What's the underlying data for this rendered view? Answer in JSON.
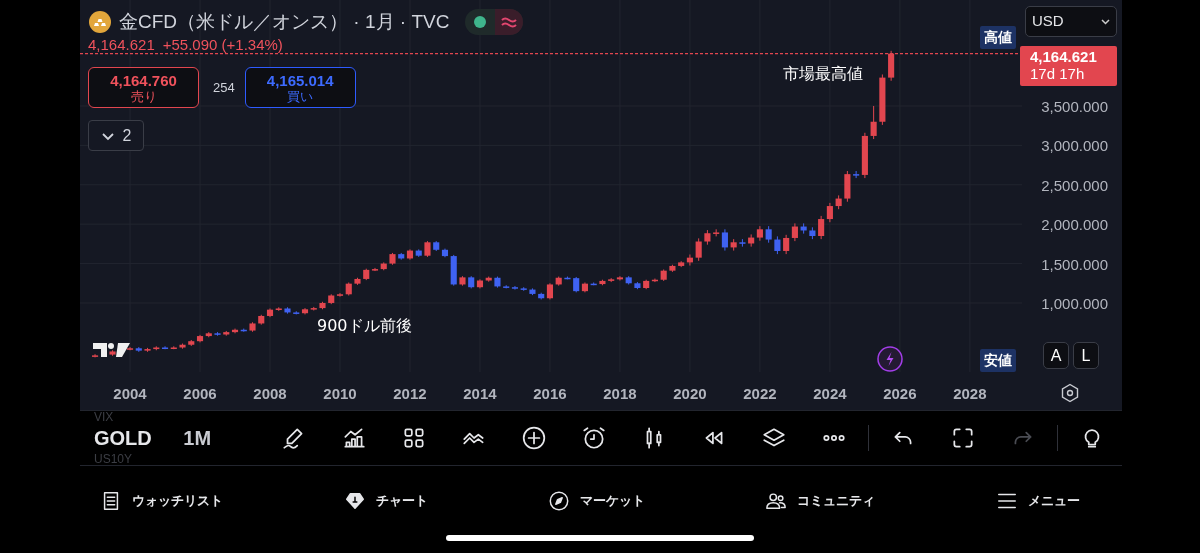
{
  "header": {
    "title": "金CFD（米ドル／オンス）",
    "meta": "· 1月 · TVC",
    "last": "4,164.621",
    "change": "+55.090 (+1.34%)"
  },
  "trade": {
    "sell_price": "4,164.760",
    "sell_label": "売り",
    "spread": "254",
    "buy_price": "4,165.014",
    "buy_label": "買い"
  },
  "indicators_count": "2",
  "price_axis": {
    "currency": "USD",
    "tag_countdown": "17d 17h",
    "high_label": "高値",
    "low_label": "安値",
    "scale_buttons": [
      "A",
      "L"
    ]
  },
  "chart_data": {
    "type": "candlestick",
    "grid": true,
    "xlim": [
      2002.57,
      2029.49
    ],
    "ylim": [
      124,
      4845
    ],
    "xticks": [
      2004,
      2006,
      2008,
      2010,
      2012,
      2014,
      2016,
      2018,
      2020,
      2022,
      2024,
      2026,
      2028
    ],
    "yticks": [
      {
        "value": 1000,
        "label": "1,000.000"
      },
      {
        "value": 1500,
        "label": "1,500.000"
      },
      {
        "value": 2000,
        "label": "2,000.000"
      },
      {
        "value": 2500,
        "label": "2,500.000"
      },
      {
        "value": 3000,
        "label": "3,000.000"
      },
      {
        "value": 3500,
        "label": "3,500.000"
      }
    ],
    "x": [
      2003,
      2003.5,
      2004,
      2004.25,
      2004.5,
      2004.75,
      2005,
      2005.25,
      2005.5,
      2005.75,
      2006,
      2006.25,
      2006.5,
      2006.75,
      2007,
      2007.25,
      2007.5,
      2007.75,
      2008,
      2008.25,
      2008.5,
      2008.75,
      2009,
      2009.25,
      2009.5,
      2009.75,
      2010,
      2010.25,
      2010.5,
      2010.75,
      2011,
      2011.25,
      2011.5,
      2011.75,
      2012,
      2012.25,
      2012.5,
      2012.75,
      2013,
      2013.25,
      2013.5,
      2013.75,
      2014,
      2014.25,
      2014.5,
      2014.75,
      2015,
      2015.25,
      2015.5,
      2015.75,
      2016,
      2016.25,
      2016.5,
      2016.75,
      2017,
      2017.25,
      2017.5,
      2017.75,
      2018,
      2018.25,
      2018.5,
      2018.75,
      2019,
      2019.25,
      2019.5,
      2019.75,
      2020,
      2020.25,
      2020.5,
      2020.75,
      2021,
      2021.25,
      2021.5,
      2021.75,
      2022,
      2022.25,
      2022.5,
      2022.75,
      2023,
      2023.25,
      2023.5,
      2023.75,
      2024,
      2024.25,
      2024.5,
      2024.75,
      2025,
      2025.25,
      2025.5,
      2025.75
    ],
    "ohlc": [
      [
        325,
        350,
        310,
        335
      ],
      [
        345,
        400,
        330,
        385
      ],
      [
        415,
        440,
        400,
        425
      ],
      [
        425,
        440,
        380,
        395
      ],
      [
        395,
        430,
        380,
        415
      ],
      [
        415,
        450,
        400,
        435
      ],
      [
        435,
        450,
        413,
        428
      ],
      [
        428,
        450,
        413,
        435
      ],
      [
        435,
        485,
        420,
        470
      ],
      [
        470,
        530,
        455,
        515
      ],
      [
        515,
        595,
        500,
        580
      ],
      [
        580,
        630,
        565,
        615
      ],
      [
        615,
        630,
        585,
        600
      ],
      [
        600,
        645,
        585,
        630
      ],
      [
        630,
        675,
        615,
        660
      ],
      [
        660,
        675,
        635,
        650
      ],
      [
        650,
        755,
        635,
        740
      ],
      [
        740,
        850,
        725,
        835
      ],
      [
        835,
        930,
        820,
        915
      ],
      [
        915,
        945,
        900,
        930
      ],
      [
        930,
        945,
        865,
        880
      ],
      [
        880,
        895,
        855,
        870
      ],
      [
        870,
        935,
        855,
        920
      ],
      [
        920,
        950,
        905,
        935
      ],
      [
        935,
        1015,
        920,
        1000
      ],
      [
        1000,
        1110,
        985,
        1095
      ],
      [
        1095,
        1125,
        1080,
        1110
      ],
      [
        1110,
        1260,
        1095,
        1245
      ],
      [
        1245,
        1320,
        1230,
        1305
      ],
      [
        1305,
        1435,
        1290,
        1420
      ],
      [
        1420,
        1445,
        1405,
        1430
      ],
      [
        1430,
        1515,
        1415,
        1500
      ],
      [
        1500,
        1635,
        1485,
        1620
      ],
      [
        1620,
        1635,
        1550,
        1565
      ],
      [
        1565,
        1680,
        1550,
        1665
      ],
      [
        1665,
        1680,
        1585,
        1600
      ],
      [
        1600,
        1785,
        1585,
        1770
      ],
      [
        1770,
        1785,
        1660,
        1675
      ],
      [
        1675,
        1690,
        1580,
        1595
      ],
      [
        1595,
        1610,
        1220,
        1235
      ],
      [
        1235,
        1340,
        1220,
        1325
      ],
      [
        1325,
        1340,
        1185,
        1200
      ],
      [
        1200,
        1300,
        1185,
        1285
      ],
      [
        1285,
        1335,
        1270,
        1320
      ],
      [
        1320,
        1335,
        1195,
        1210
      ],
      [
        1210,
        1225,
        1185,
        1200
      ],
      [
        1200,
        1215,
        1170,
        1185
      ],
      [
        1185,
        1200,
        1155,
        1170
      ],
      [
        1170,
        1185,
        1100,
        1115
      ],
      [
        1115,
        1130,
        1045,
        1060
      ],
      [
        1060,
        1250,
        1045,
        1235
      ],
      [
        1235,
        1335,
        1220,
        1320
      ],
      [
        1320,
        1335,
        1300,
        1315
      ],
      [
        1315,
        1330,
        1135,
        1150
      ],
      [
        1150,
        1260,
        1135,
        1245
      ],
      [
        1245,
        1260,
        1225,
        1240
      ],
      [
        1240,
        1295,
        1225,
        1280
      ],
      [
        1280,
        1315,
        1265,
        1300
      ],
      [
        1300,
        1340,
        1285,
        1325
      ],
      [
        1325,
        1340,
        1235,
        1250
      ],
      [
        1250,
        1265,
        1175,
        1190
      ],
      [
        1190,
        1295,
        1175,
        1280
      ],
      [
        1280,
        1310,
        1265,
        1295
      ],
      [
        1295,
        1425,
        1280,
        1410
      ],
      [
        1410,
        1485,
        1395,
        1470
      ],
      [
        1470,
        1530,
        1455,
        1515
      ],
      [
        1515,
        1615,
        1475,
        1575
      ],
      [
        1575,
        1820,
        1535,
        1780
      ],
      [
        1780,
        1925,
        1740,
        1885
      ],
      [
        1885,
        1935,
        1845,
        1895
      ],
      [
        1895,
        1935,
        1665,
        1705
      ],
      [
        1705,
        1810,
        1665,
        1770
      ],
      [
        1770,
        1810,
        1715,
        1755
      ],
      [
        1755,
        1870,
        1715,
        1830
      ],
      [
        1830,
        1975,
        1790,
        1935
      ],
      [
        1935,
        1975,
        1765,
        1805
      ],
      [
        1805,
        1845,
        1620,
        1660
      ],
      [
        1660,
        1865,
        1620,
        1825
      ],
      [
        1825,
        2010,
        1785,
        1970
      ],
      [
        1970,
        2010,
        1880,
        1920
      ],
      [
        1920,
        1960,
        1810,
        1850
      ],
      [
        1850,
        2105,
        1810,
        2065
      ],
      [
        2065,
        2270,
        2025,
        2230
      ],
      [
        2230,
        2365,
        2190,
        2325
      ],
      [
        2325,
        2675,
        2285,
        2635
      ],
      [
        2635,
        2675,
        2585,
        2625
      ],
      [
        2625,
        3160,
        2585,
        3120
      ],
      [
        3120,
        3500,
        3080,
        3300
      ],
      [
        3300,
        3900,
        3260,
        3860
      ],
      [
        3860,
        4200,
        3820,
        4165
      ]
    ],
    "ref_lines": [
      {
        "axis": "y",
        "value": 4164.621,
        "color": "#e2464f",
        "label": "4,164.621"
      }
    ],
    "annotations": [
      "市場最高値",
      "900ドル前後"
    ]
  },
  "toolbar": {
    "symbol": "GOLD",
    "interval": "1M",
    "prev_symbol": "VIX",
    "next_symbol": "US10Y",
    "tools": [
      {
        "kind": "draw",
        "disabled": false
      },
      {
        "kind": "indicators",
        "disabled": false
      },
      {
        "kind": "grid",
        "disabled": false
      },
      {
        "kind": "patterns",
        "disabled": false
      },
      {
        "kind": "add",
        "disabled": false
      },
      {
        "kind": "alarm",
        "disabled": false
      },
      {
        "kind": "candles",
        "disabled": false
      },
      {
        "kind": "replay",
        "disabled": false
      },
      {
        "kind": "layers",
        "disabled": false
      },
      {
        "kind": "more",
        "disabled": false
      },
      {
        "kind": "divider",
        "disabled": false
      },
      {
        "kind": "undo",
        "disabled": false
      },
      {
        "kind": "fullscreen",
        "disabled": false
      },
      {
        "kind": "redo",
        "disabled": true
      },
      {
        "kind": "divider",
        "disabled": false
      },
      {
        "kind": "bulb",
        "disabled": false
      }
    ]
  },
  "nav": [
    {
      "kind": "watchlist",
      "label": "ウォッチリスト"
    },
    {
      "kind": "chart",
      "label": "チャート"
    },
    {
      "kind": "market",
      "label": "マーケット"
    },
    {
      "kind": "community",
      "label": "コミュニティ"
    },
    {
      "kind": "menu",
      "label": "メニュー"
    }
  ]
}
